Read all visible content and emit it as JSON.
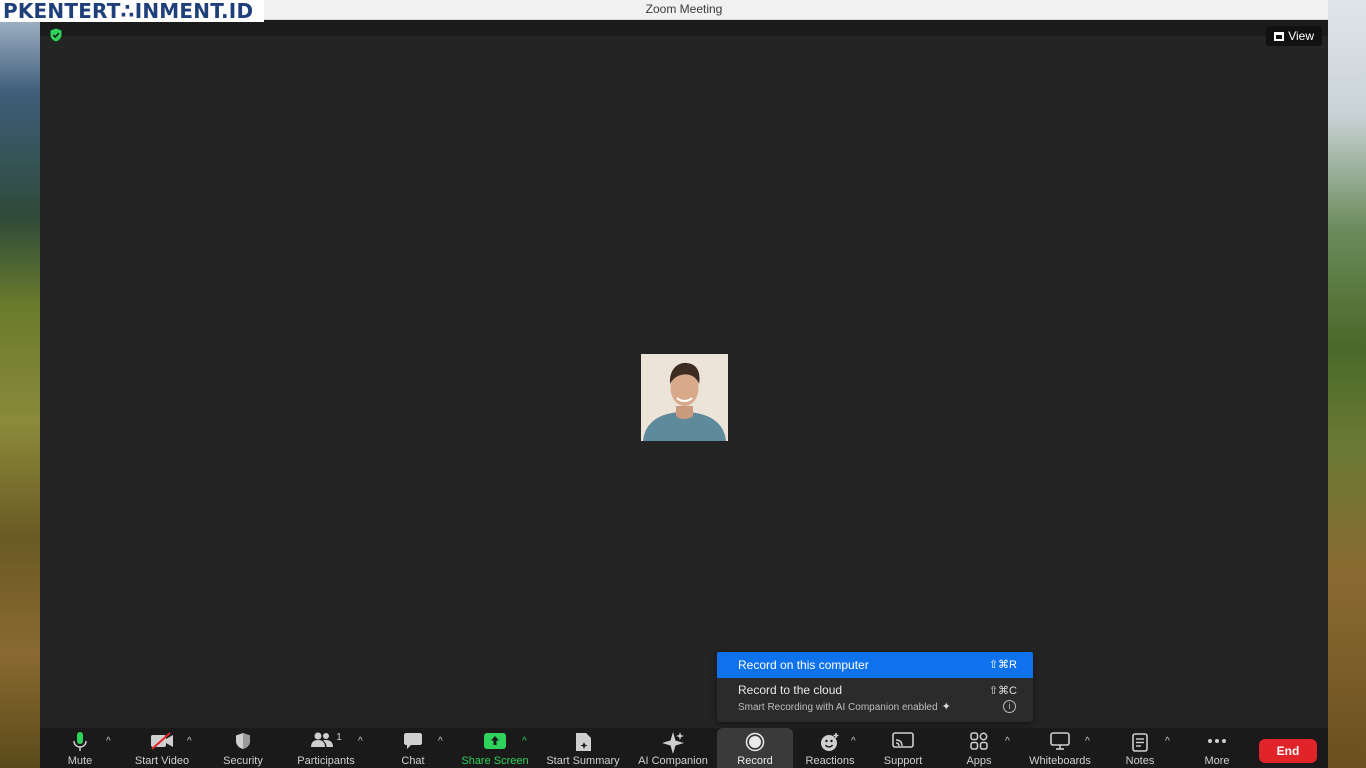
{
  "watermark": "PKENTERT∴INMENT.ID",
  "window": {
    "title": "Zoom Meeting"
  },
  "top_controls": {
    "view_label": "View"
  },
  "record_menu": {
    "local_label": "Record on this computer",
    "local_shortcut": "⇧⌘R",
    "cloud_label": "Record to the cloud",
    "cloud_shortcut": "⇧⌘C",
    "cloud_subtext": "Smart Recording with AI Companion enabled",
    "info_glyph": "i"
  },
  "toolbar": {
    "mute": "Mute",
    "start_video": "Start Video",
    "security": "Security",
    "participants": "Participants",
    "participant_count": "1",
    "chat": "Chat",
    "share_screen": "Share Screen",
    "start_summary": "Start Summary",
    "ai_companion": "AI Companion",
    "record": "Record",
    "reactions": "Reactions",
    "support": "Support",
    "apps": "Apps",
    "whiteboards": "Whiteboards",
    "notes": "Notes",
    "more": "More",
    "end": "End"
  },
  "colors": {
    "accent_blue": "#0e72ed",
    "share_green": "#2fd25a",
    "end_red": "#e0242a",
    "secure_green": "#2fd25a"
  },
  "icons": [
    "shield-check-icon",
    "view-grid-icon",
    "microphone-icon",
    "video-off-icon",
    "security-shield-icon",
    "participants-icon",
    "chat-icon",
    "share-screen-icon",
    "summary-icon",
    "ai-sparkle-icon",
    "record-icon",
    "reactions-icon",
    "support-icon",
    "apps-icon",
    "whiteboard-icon",
    "notes-icon",
    "more-dots-icon",
    "chevron-up-icon",
    "info-icon"
  ]
}
